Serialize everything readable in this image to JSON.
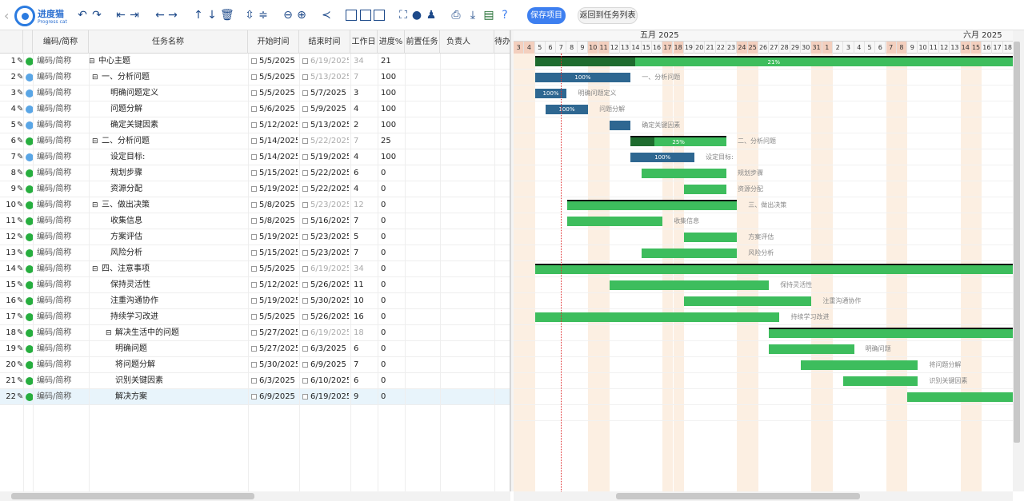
{
  "app": {
    "name": "进度猫",
    "subtitle": "Progress cat"
  },
  "toolbar": {
    "icons": [
      "undo-icon",
      "redo-icon",
      "outdent-icon",
      "indent-icon",
      "arrow-left-icon",
      "arrow-right-icon",
      "arrow-up-icon",
      "arrow-down-icon",
      "trash-icon",
      "expand-all-icon",
      "collapse-all-icon",
      "zoom-out-icon",
      "zoom-in-icon",
      "share-icon",
      "layout-left-icon",
      "layout-split-icon",
      "layout-right-icon",
      "fullscreen-icon",
      "palette-icon",
      "users-icon",
      "print-icon",
      "export-icon",
      "excel-icon",
      "help-icon"
    ],
    "save_label": "保存项目",
    "back_label": "返回到任务列表"
  },
  "grid": {
    "headers": {
      "code": "编码/简称",
      "name": "任务名称",
      "start": "开始时间",
      "end": "结束时间",
      "days": "工作日",
      "progress": "进度%",
      "pred": "前置任务",
      "owner": "负责人",
      "pending": "待办"
    },
    "rows": [
      {
        "num": "1",
        "code": "编码/简称",
        "name": "中心主题",
        "start": "5/5/2025",
        "end": "6/19/2025",
        "days": "34",
        "progress": "21",
        "level": 0,
        "group": true,
        "dot": "#27ae3f"
      },
      {
        "num": "2",
        "code": "编码/简称",
        "name": "一、分析问题",
        "start": "5/5/2025",
        "end": "5/13/2025",
        "days": "7",
        "progress": "100",
        "level": 1,
        "group": true,
        "dot": "#5aa6e6"
      },
      {
        "num": "3",
        "code": "编码/简称",
        "name": "明确问题定义",
        "start": "5/5/2025",
        "end": "5/7/2025",
        "days": "3",
        "progress": "100",
        "level": 2,
        "group": false,
        "dot": "#5aa6e6"
      },
      {
        "num": "4",
        "code": "编码/简称",
        "name": "问题分解",
        "start": "5/6/2025",
        "end": "5/9/2025",
        "days": "4",
        "progress": "100",
        "level": 2,
        "group": false,
        "dot": "#5aa6e6"
      },
      {
        "num": "5",
        "code": "编码/简称",
        "name": "确定关键因素",
        "start": "5/12/2025",
        "end": "5/13/2025",
        "days": "2",
        "progress": "100",
        "level": 2,
        "group": false,
        "dot": "#5aa6e6"
      },
      {
        "num": "6",
        "code": "编码/简称",
        "name": "二、分析问题",
        "start": "5/14/2025",
        "end": "5/22/2025",
        "days": "7",
        "progress": "25",
        "level": 1,
        "group": true,
        "dot": "#27ae3f"
      },
      {
        "num": "7",
        "code": "编码/简称",
        "name": "设定目标:",
        "start": "5/14/2025",
        "end": "5/19/2025",
        "days": "4",
        "progress": "100",
        "level": 2,
        "group": false,
        "dot": "#5aa6e6"
      },
      {
        "num": "8",
        "code": "编码/简称",
        "name": "规划步骤",
        "start": "5/15/2025",
        "end": "5/22/2025",
        "days": "6",
        "progress": "0",
        "level": 2,
        "group": false,
        "dot": "#27ae3f"
      },
      {
        "num": "9",
        "code": "编码/简称",
        "name": "资源分配",
        "start": "5/19/2025",
        "end": "5/22/2025",
        "days": "4",
        "progress": "0",
        "level": 2,
        "group": false,
        "dot": "#27ae3f"
      },
      {
        "num": "10",
        "code": "编码/简称",
        "name": "三、做出决策",
        "start": "5/8/2025",
        "end": "5/23/2025",
        "days": "12",
        "progress": "0",
        "level": 1,
        "group": true,
        "dot": "#27ae3f"
      },
      {
        "num": "11",
        "code": "编码/简称",
        "name": "收集信息",
        "start": "5/8/2025",
        "end": "5/16/2025",
        "days": "7",
        "progress": "0",
        "level": 2,
        "group": false,
        "dot": "#27ae3f"
      },
      {
        "num": "12",
        "code": "编码/简称",
        "name": "方案评估",
        "start": "5/19/2025",
        "end": "5/23/2025",
        "days": "5",
        "progress": "0",
        "level": 2,
        "group": false,
        "dot": "#27ae3f"
      },
      {
        "num": "13",
        "code": "编码/简称",
        "name": "风险分析",
        "start": "5/15/2025",
        "end": "5/23/2025",
        "days": "7",
        "progress": "0",
        "level": 2,
        "group": false,
        "dot": "#27ae3f"
      },
      {
        "num": "14",
        "code": "编码/简称",
        "name": "四、注意事项",
        "start": "5/5/2025",
        "end": "6/19/2025",
        "days": "34",
        "progress": "0",
        "level": 1,
        "group": true,
        "dot": "#27ae3f"
      },
      {
        "num": "15",
        "code": "编码/简称",
        "name": "保持灵活性",
        "start": "5/12/2025",
        "end": "5/26/2025",
        "days": "11",
        "progress": "0",
        "level": 2,
        "group": false,
        "dot": "#27ae3f"
      },
      {
        "num": "16",
        "code": "编码/简称",
        "name": "注重沟通协作",
        "start": "5/19/2025",
        "end": "5/30/2025",
        "days": "10",
        "progress": "0",
        "level": 2,
        "group": false,
        "dot": "#27ae3f"
      },
      {
        "num": "17",
        "code": "编码/简称",
        "name": "持续学习改进",
        "start": "5/5/2025",
        "end": "5/26/2025",
        "days": "16",
        "progress": "0",
        "level": 2,
        "group": false,
        "dot": "#27ae3f"
      },
      {
        "num": "18",
        "code": "编码/简称",
        "name": "解决生活中的问题",
        "start": "5/27/2025",
        "end": "6/19/2025",
        "days": "18",
        "progress": "0",
        "level": 2,
        "group": true,
        "dot": "#27ae3f"
      },
      {
        "num": "19",
        "code": "编码/简称",
        "name": "明确问题",
        "start": "5/27/2025",
        "end": "6/3/2025",
        "days": "6",
        "progress": "0",
        "level": 3,
        "group": false,
        "dot": "#27ae3f"
      },
      {
        "num": "20",
        "code": "编码/简称",
        "name": "将问题分解",
        "start": "5/30/2025",
        "end": "6/9/2025",
        "days": "7",
        "progress": "0",
        "level": 3,
        "group": false,
        "dot": "#27ae3f"
      },
      {
        "num": "21",
        "code": "编码/简称",
        "name": "识别关键因素",
        "start": "6/3/2025",
        "end": "6/10/2025",
        "days": "6",
        "progress": "0",
        "level": 3,
        "group": false,
        "dot": "#27ae3f"
      },
      {
        "num": "22",
        "code": "编码/简称",
        "name": "解决方案",
        "start": "6/9/2025",
        "end": "6/19/2025",
        "days": "9",
        "progress": "0",
        "level": 3,
        "group": false,
        "dot": "#27ae3f",
        "selected": true
      }
    ]
  },
  "gantt": {
    "months": [
      "五月 2025",
      "六月 2025"
    ],
    "days": [
      "3",
      "4",
      "5",
      "6",
      "7",
      "8",
      "9",
      "10",
      "11",
      "12",
      "13",
      "14",
      "15",
      "16",
      "17",
      "18",
      "19",
      "20",
      "21",
      "22",
      "23",
      "24",
      "25",
      "26",
      "27",
      "28",
      "29",
      "30",
      "31",
      "1",
      "2",
      "3",
      "4",
      "5",
      "6",
      "7",
      "8",
      "9",
      "10",
      "11",
      "12",
      "13",
      "14",
      "15",
      "16",
      "17",
      "18"
    ],
    "weekend_days": [
      0,
      1,
      7,
      8,
      14,
      15,
      21,
      22,
      28,
      29,
      35,
      36,
      42,
      43
    ],
    "tasks": [
      {
        "start": 2,
        "end": 47,
        "progress": 21,
        "label": "",
        "pct": "21%",
        "type": "summary"
      },
      {
        "start": 2,
        "end": 11,
        "progress": 100,
        "label": "一、分析问题",
        "pct": "100%",
        "type": "blue"
      },
      {
        "start": 2,
        "end": 5,
        "progress": 100,
        "label": "明确问题定义",
        "pct": "100%",
        "type": "blue"
      },
      {
        "start": 3,
        "end": 7,
        "progress": 100,
        "label": "问题分解",
        "pct": "100%",
        "type": "blue"
      },
      {
        "start": 9,
        "end": 11,
        "progress": 100,
        "label": "确定关键因素",
        "pct": "",
        "type": "blue"
      },
      {
        "start": 11,
        "end": 20,
        "progress": 25,
        "label": "二、分析问题",
        "pct": "25%",
        "type": "summary"
      },
      {
        "start": 11,
        "end": 17,
        "progress": 100,
        "label": "设定目标:",
        "pct": "100%",
        "type": "blue"
      },
      {
        "start": 12,
        "end": 20,
        "progress": 0,
        "label": "规划步骤",
        "pct": "",
        "type": "green"
      },
      {
        "start": 16,
        "end": 20,
        "progress": 0,
        "label": "资源分配",
        "pct": "",
        "type": "green"
      },
      {
        "start": 5,
        "end": 21,
        "progress": 0,
        "label": "三、做出决策",
        "pct": "",
        "type": "summary"
      },
      {
        "start": 5,
        "end": 14,
        "progress": 0,
        "label": "收集信息",
        "pct": "",
        "type": "green"
      },
      {
        "start": 16,
        "end": 21,
        "progress": 0,
        "label": "方案评估",
        "pct": "",
        "type": "green"
      },
      {
        "start": 12,
        "end": 21,
        "progress": 0,
        "label": "风险分析",
        "pct": "",
        "type": "green"
      },
      {
        "start": 2,
        "end": 47,
        "progress": 0,
        "label": "",
        "pct": "",
        "type": "summary"
      },
      {
        "start": 9,
        "end": 24,
        "progress": 0,
        "label": "保持灵活性",
        "pct": "",
        "type": "green"
      },
      {
        "start": 16,
        "end": 28,
        "progress": 0,
        "label": "注重沟通协作",
        "pct": "",
        "type": "green"
      },
      {
        "start": 2,
        "end": 25,
        "progress": 0,
        "label": "持续学习改进",
        "pct": "",
        "type": "green"
      },
      {
        "start": 24,
        "end": 47,
        "progress": 0,
        "label": "",
        "pct": "",
        "type": "summary"
      },
      {
        "start": 24,
        "end": 32,
        "progress": 0,
        "label": "明确问题",
        "pct": "",
        "type": "green"
      },
      {
        "start": 27,
        "end": 38,
        "progress": 0,
        "label": "将问题分解",
        "pct": "",
        "type": "green"
      },
      {
        "start": 31,
        "end": 38,
        "progress": 0,
        "label": "识别关键因素",
        "pct": "",
        "type": "green"
      },
      {
        "start": 37,
        "end": 47,
        "progress": 0,
        "label": "",
        "pct": "",
        "type": "green"
      }
    ]
  },
  "colors": {
    "accent": "#3d7ff0",
    "bar_green": "#3dbd5d",
    "bar_blue": "#4b86b4",
    "summary_done": "#1e6b2e",
    "blue_done": "#2e6791",
    "weekend": "#f3cfbe"
  }
}
